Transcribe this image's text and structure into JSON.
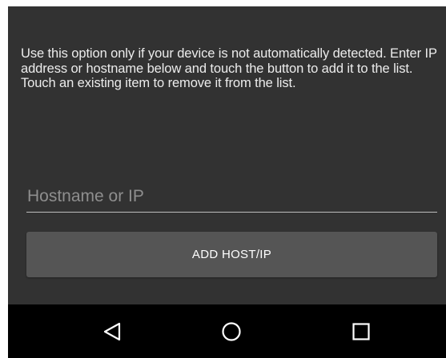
{
  "description": "Use this option only if your device is not automatically detected. Enter IP address or hostname below and touch the button to add it to the list. Touch an existing item to remove it from the list.",
  "host_input": {
    "placeholder": "Hostname or IP",
    "value": ""
  },
  "add_button": {
    "label": "ADD HOST/IP"
  },
  "nav_bar": {
    "icons": [
      "back-icon",
      "home-icon",
      "recents-icon"
    ]
  },
  "colors": {
    "content_background": "#323232",
    "button_background": "#555555",
    "nav_background": "#000000",
    "text": "#ececec",
    "placeholder": "#8e8e8e"
  }
}
